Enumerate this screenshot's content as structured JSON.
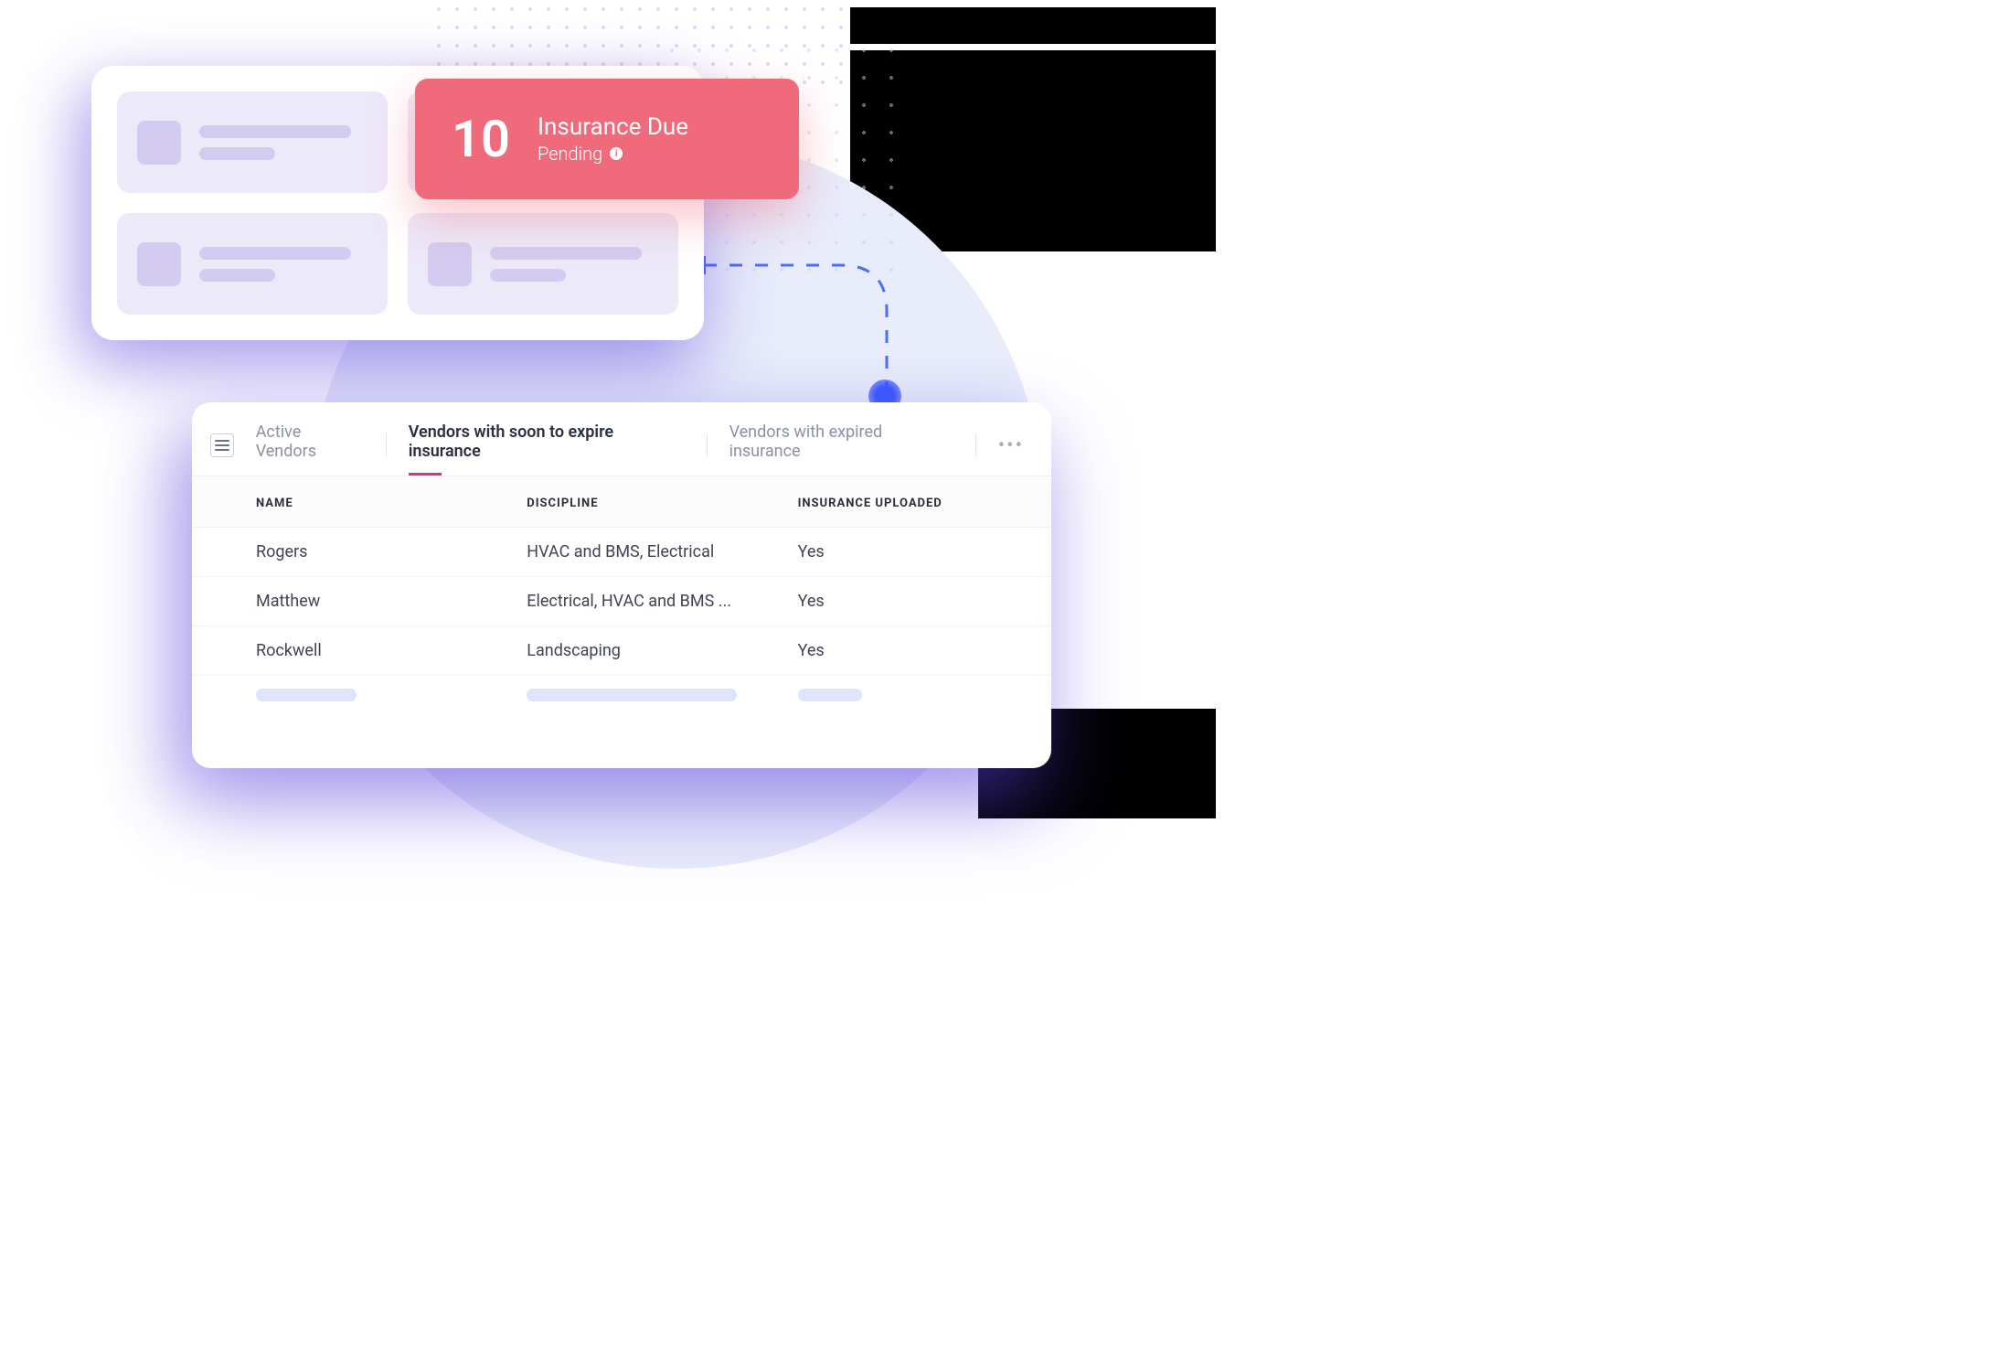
{
  "alert": {
    "count": "10",
    "title": "Insurance Due",
    "subtitle": "Pending"
  },
  "tabs": {
    "active_vendors": "Active Vendors",
    "soon_expire": "Vendors with soon to expire insurance",
    "expired": "Vendors with expired insurance"
  },
  "table": {
    "headers": {
      "name": "NAME",
      "discipline": "DISCIPLINE",
      "insurance": "INSURANCE UPLOADED"
    },
    "rows": [
      {
        "name": "Rogers",
        "discipline": "HVAC and BMS, Electrical",
        "insurance": "Yes"
      },
      {
        "name": "Matthew",
        "discipline": "Electrical, HVAC and BMS ...",
        "insurance": "Yes"
      },
      {
        "name": "Rockwell",
        "discipline": "Landscaping",
        "insurance": "Yes"
      }
    ]
  }
}
